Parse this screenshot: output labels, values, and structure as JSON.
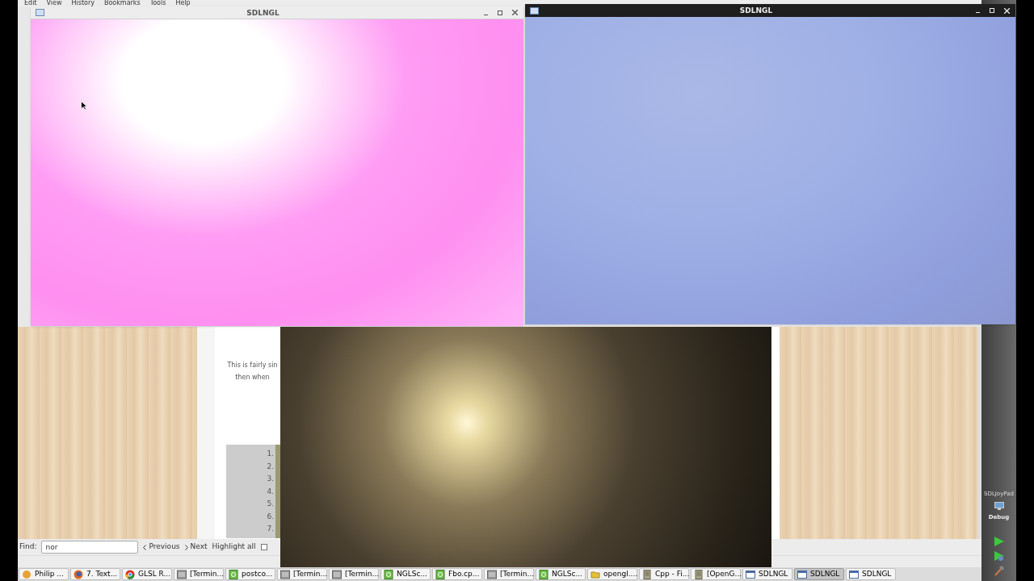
{
  "browser": {
    "menu": [
      "Edit",
      "View",
      "History",
      "Bookmarks",
      "Tools",
      "Help"
    ],
    "page": {
      "paragraph_lines": [
        "This is fairly sin",
        "then when"
      ],
      "code_line_numbers": [
        "1.",
        "2.",
        "3.",
        "4.",
        "5.",
        "6.",
        "7."
      ]
    },
    "find_bar": {
      "label": "Find:",
      "value": "nor",
      "previous": "Previous",
      "next": "Next",
      "highlight_all": "Highlight all",
      "match_case_checked": false
    }
  },
  "windows": [
    {
      "title": "SDLNGL",
      "kind": "light"
    },
    {
      "title": "SDLNGL",
      "kind": "dark"
    },
    {
      "kind": "frameless"
    }
  ],
  "ide_dock": {
    "project": "SDLJoyPad",
    "build_mode": "Debug"
  },
  "taskbar": [
    {
      "label": "Philip ...",
      "kind": "app",
      "selected": false
    },
    {
      "label": "7. Text...",
      "kind": "firefox",
      "selected": false
    },
    {
      "label": "GLSL R...",
      "kind": "chrome",
      "selected": false
    },
    {
      "label": "[Termin...",
      "kind": "terminal",
      "selected": false
    },
    {
      "label": "postco...",
      "kind": "qt",
      "selected": false
    },
    {
      "label": "[Termin...",
      "kind": "terminal",
      "selected": false
    },
    {
      "label": "[Termin...",
      "kind": "terminal",
      "selected": false
    },
    {
      "label": "NGLSc...",
      "kind": "qt",
      "selected": false
    },
    {
      "label": "Fbo.cp...",
      "kind": "qt",
      "selected": false
    },
    {
      "label": "[Termin...",
      "kind": "terminal",
      "selected": false
    },
    {
      "label": "NGLSc...",
      "kind": "qt",
      "selected": false
    },
    {
      "label": "opengl....",
      "kind": "folder",
      "selected": false
    },
    {
      "label": "Cpp - Fi...",
      "kind": "document",
      "selected": false
    },
    {
      "label": "[OpenG...",
      "kind": "document",
      "selected": false
    },
    {
      "label": "SDLNGL",
      "kind": "window",
      "selected": false
    },
    {
      "label": "SDLNGL",
      "kind": "window",
      "selected": true
    },
    {
      "label": "SDLNGL",
      "kind": "window",
      "selected": false
    }
  ]
}
